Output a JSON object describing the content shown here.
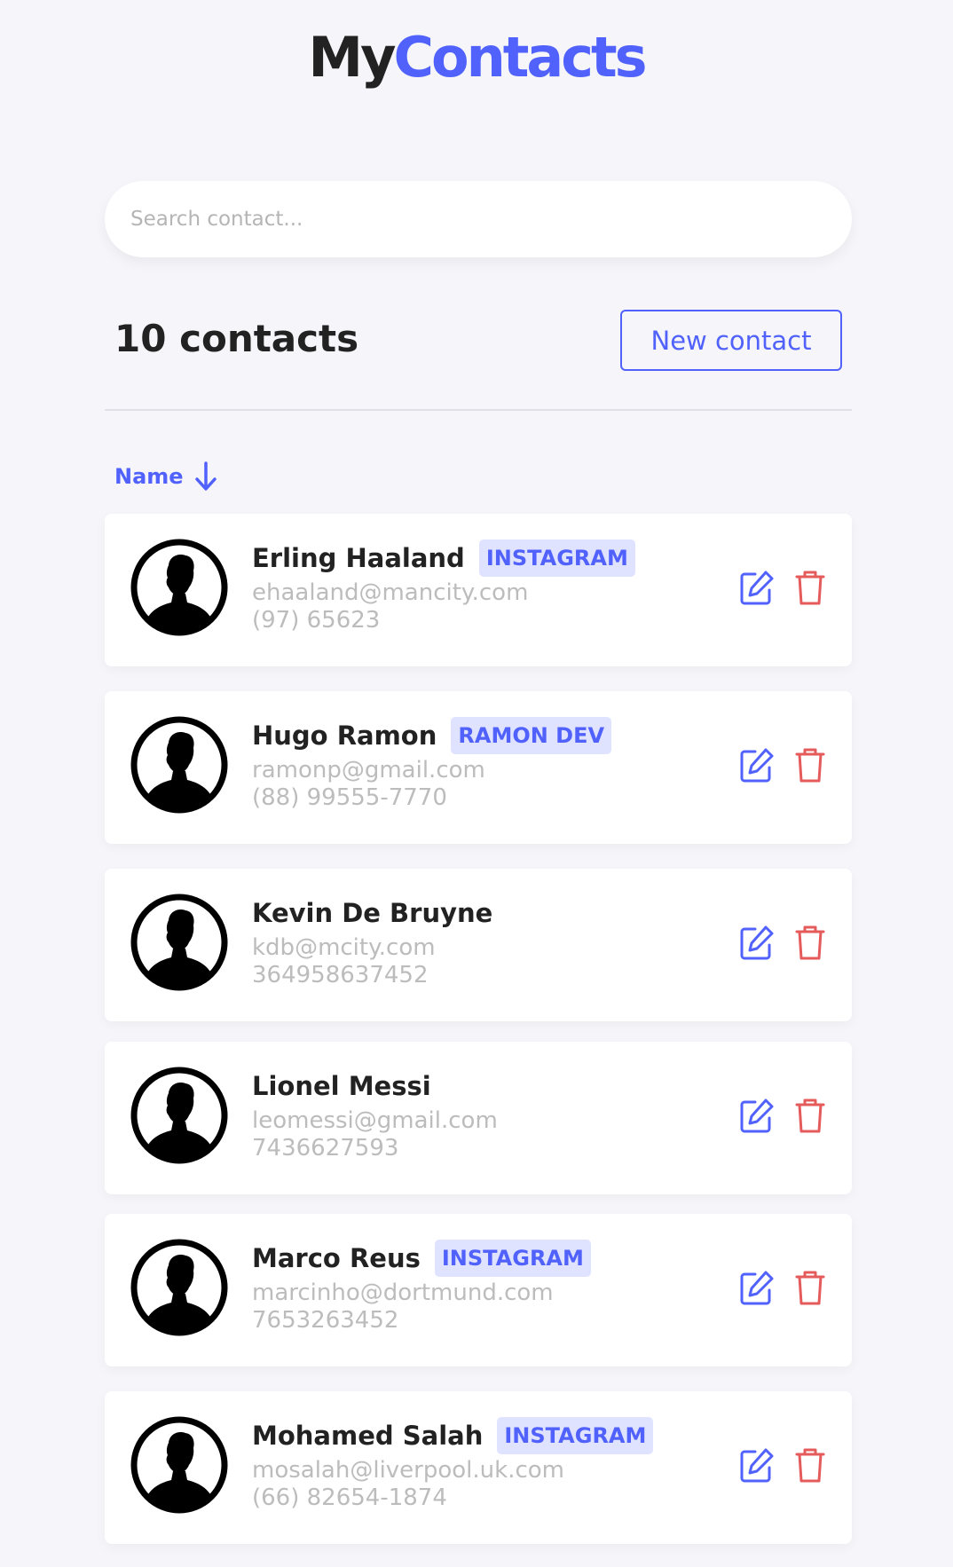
{
  "header": {
    "logo_my": "My",
    "logo_contacts": "Contacts"
  },
  "search": {
    "placeholder": "Search contact...",
    "value": ""
  },
  "toolbar": {
    "count_label": "10 contacts",
    "new_contact_label": "New contact"
  },
  "sort": {
    "label": "Name",
    "direction": "descending-arrow"
  },
  "colors": {
    "accent": "#5061fc",
    "danger": "#e55b5b",
    "background": "#f5f5fa",
    "badge_bg": "#e0e3ff"
  },
  "contacts": [
    {
      "name": "Erling Haaland",
      "category": "INSTAGRAM",
      "email": "ehaaland@mancity.com",
      "phone": "(97) 65623"
    },
    {
      "name": "Hugo Ramon",
      "category": "RAMON DEV",
      "email": "ramonp@gmail.com",
      "phone": "(88) 99555-7770"
    },
    {
      "name": "Kevin De Bruyne",
      "category": "",
      "email": "kdb@mcity.com",
      "phone": "364958637452"
    },
    {
      "name": "Lionel Messi",
      "category": "",
      "email": "leomessi@gmail.com",
      "phone": "7436627593"
    },
    {
      "name": "Marco Reus",
      "category": "INSTAGRAM",
      "email": "marcinho@dortmund.com",
      "phone": "7653263452"
    },
    {
      "name": "Mohamed Salah",
      "category": "INSTAGRAM",
      "email": "mosalah@liverpool.uk.com",
      "phone": "(66) 82654-1874"
    }
  ]
}
